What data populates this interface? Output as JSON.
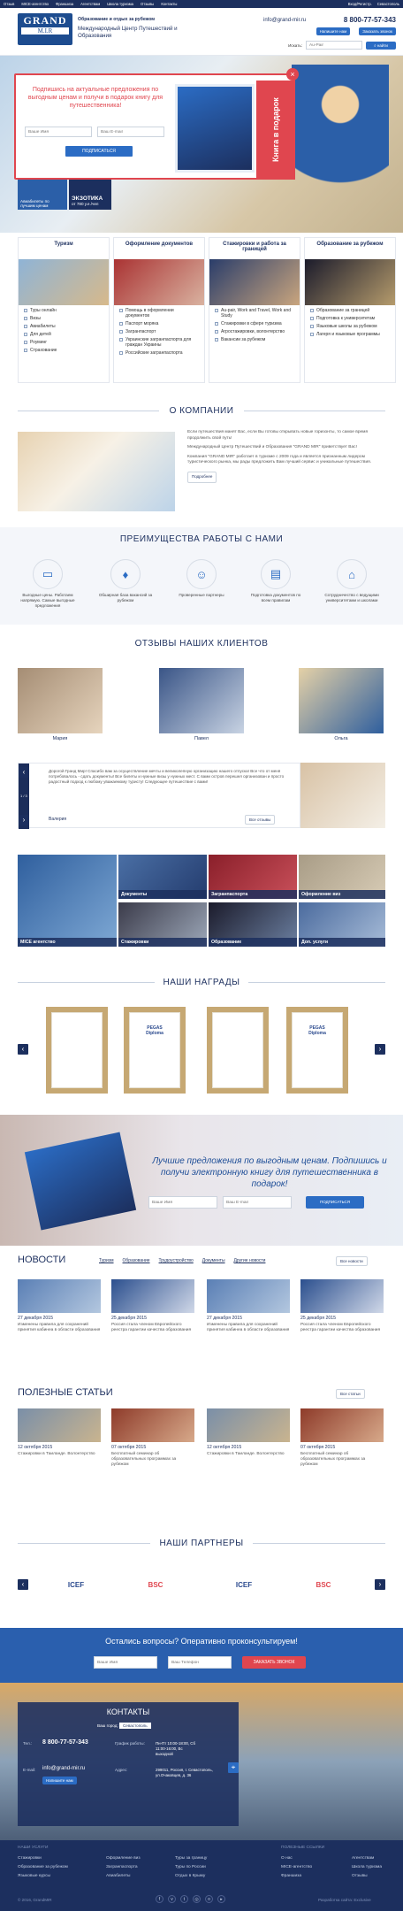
{
  "topbar": {
    "items": [
      "Отзыв",
      "MICE-агентство",
      "Франшиза",
      "Агентствам",
      "Школа туризма",
      "Отзывы",
      "Контакты"
    ],
    "login": "Вход/Регистр.",
    "city": "Севастополь"
  },
  "header": {
    "logo_main": "GRAND",
    "logo_sub": "M.I.R",
    "tagline": "Образование и отдых за рубежом",
    "org": "Международный Центр Путешествий и Образования",
    "email": "info@grand-mir.ru",
    "phone": "8 800-77-57-343",
    "callback_btn": "Напишите нам",
    "order_btn": "Заказать звонок",
    "search_label": "Искать:",
    "search_placeholder": "Au-Pair",
    "search_btn": "найти"
  },
  "popup": {
    "text": "Подпишись на актуальные предложения по выгодным ценам и получи в подарок книгу для путешественника!",
    "name_placeholder": "Ваше Имя",
    "email_placeholder": "Ваш E-mail",
    "subscribe": "ПОДПИСАТЬСЯ",
    "book_label": "Книга в подарок",
    "close": "×"
  },
  "hero": {
    "badge1": "Авиабилеты по лучшим ценам",
    "badge2_title": "ЭКЗОТИКА",
    "badge2_price": "от 780 у.е./чел"
  },
  "services": [
    {
      "title": "Туризм",
      "items": [
        "Туры онлайн",
        "Визы",
        "Авиабилеты",
        "Для детей",
        "Роуминг",
        "Страхование"
      ]
    },
    {
      "title": "Оформление документов",
      "items": [
        "Помощь в оформлении документов",
        "Паспорт моряка",
        "Загранпаспорт",
        "Украинские загранпаспорта для граждан Украины",
        "Российские загранпаспорта"
      ]
    },
    {
      "title": "Стажировки и работа за границей",
      "items": [
        "Au-pair, Work and Travel, Work and Study",
        "Стажировки в сфере туризма",
        "Агростажировки, волонтерство",
        "Вакансии за рубежом"
      ]
    },
    {
      "title": "Образование за рубежом",
      "items": [
        "Образование за границей",
        "Подготовка к университетам",
        "Языковые школы за рубежом",
        "Лагеря и языковые программы"
      ]
    }
  ],
  "about": {
    "title": "О КОМПАНИИ",
    "p1": "Если путешествия манят Вас, если Вы готовы открывать новые горизонты, то самое время продолжить свой путь!",
    "p2": "Международный Центр Путешествий и Образования \"GRAND MIR\" приветствует Вас!",
    "p3": "Компания \"GRAND MIR\" работает в туризме с 2009 года и является признанным лидером туристического рынка, мы рады предложить Вам лучший сервис и уникальные путешествия.",
    "more": "Подробнее"
  },
  "advantages": {
    "title": "ПРЕИМУЩЕСТВА РАБОТЫ С НАМИ",
    "items": [
      "Выгодные цены. Работаем напрямую. Самые выгодные предложения",
      "Обширная база вакансий за рубежом",
      "Проверенные партнеры",
      "Подготовка документов по всем правилам",
      "Сотрудничество с ведущими университетами и школами"
    ]
  },
  "reviews": {
    "title": "ОТЗЫВЫ НАШИХ КЛИЕНТОВ",
    "people": [
      "Мария",
      "Павел",
      "Ольга"
    ],
    "counter": "1 / 3",
    "text": "Дорогой Гранд Мир! Спасибо вам за осуществление мечты и великолепную организацию нашего отпуска! Все что от меня потребовалось - сдать документы! Все билеты и нужные визы у нужных мест. С вами остров перешел организован и просто радостный подход к любому уважаемому туристу! Следующее путешествие с вами!",
    "author": "Валерия",
    "all": "Все отзывы"
  },
  "tiles": [
    "MICE агентство",
    "Документы",
    "Загранпаспорта",
    "Оформление виз",
    "Стажировки",
    "Образование",
    "Доп. услуги"
  ],
  "awards": {
    "title": "НАШИ НАГРАДЫ",
    "labels": [
      "PEGAS",
      "Diploma"
    ]
  },
  "subscribe2": {
    "text": "Лучшие предложения по выгодным ценам. Подпишись и получи электронную книгу для путешественника в подарок!",
    "name_placeholder": "Ваше Имя",
    "email_placeholder": "Ваш E-mail",
    "btn": "ПОДПИСАТЬСЯ"
  },
  "news": {
    "title": "НОВОСТИ",
    "tabs": [
      "Туризм",
      "Образование",
      "Трудоустройство",
      "Документы",
      "Другие новости"
    ],
    "all": "Все новости",
    "items": [
      {
        "date": "27 декабря 2015",
        "text": "Изменены правила для сохранений принятия кабинеа в области образования"
      },
      {
        "date": "25 декабря 2015",
        "text": "Россия стала членом Европейского реестра гарантии качества образования"
      },
      {
        "date": "27 декабря 2015",
        "text": "Изменены правила для сохранений принятия кабинеа в области образования"
      },
      {
        "date": "25 декабря 2015",
        "text": "Россия стала членом Европейского реестра гарантии качества образования"
      }
    ]
  },
  "articles": {
    "title": "ПОЛЕЗНЫЕ СТАТЬИ",
    "all": "Все статьи",
    "items": [
      {
        "date": "12 октября 2015",
        "text": "Стажировки в Таиланде. Волонтерство"
      },
      {
        "date": "07 октября 2015",
        "text": "Бесплатный семинар об образовательных программах за рубежом"
      },
      {
        "date": "12 октября 2015",
        "text": "Стажировки в Таиланде. Волонтерство"
      },
      {
        "date": "07 октября 2015",
        "text": "Бесплатный семинар об образовательных программах за рубежом"
      }
    ]
  },
  "partners": {
    "title": "НАШИ ПАРТНЕРЫ",
    "logos": [
      "ICEF",
      "BSC",
      "ICEF",
      "BSC"
    ]
  },
  "cta": {
    "text": "Остались вопросы? Оперативно проконсультируем!",
    "name_placeholder": "Ваше Имя",
    "phone_placeholder": "Ваш Телефон",
    "btn": "ЗАКАЗАТЬ ЗВОНОК"
  },
  "contacts": {
    "title": "КОНТАКТЫ",
    "city_label": "Ваш город:",
    "city": "Севастополь",
    "phone_label": "Тел.:",
    "phone": "8 800-77-57-343",
    "email_label": "E-mail:",
    "email": "info@grand-mir.ru",
    "write": "Напишите нам",
    "hours_label": "График работы:",
    "hours": "Пн-Пт 10:00-18:00, Сб 11:00-16:00, Вс выходной",
    "address_label": "Адрес:",
    "address": "299011, Россия, г. Севастополь, ул.Очаковцев, д. 36"
  },
  "footer": {
    "col1_title": "НАШИ УСЛУГИ",
    "col1": [
      "Стажировки",
      "Образование за рубежом",
      "Языковые курсы"
    ],
    "col2": [
      "Оформление виз",
      "Загранпаспорта",
      "Авиабилеты"
    ],
    "col3": [
      "Туры за границу",
      "Туры по России",
      "Отдых в Крыму"
    ],
    "col4_title": "ПОЛЕЗНЫЕ ССЫЛКИ",
    "col4": [
      "О нас",
      "MICE-агентство",
      "Франшиза"
    ],
    "col5": [
      "Агентствам",
      "Школа туризма",
      "Отзывы"
    ],
    "copy": "© 2016, GrandMIR",
    "dev": "Разработка сайта: Exclusive"
  }
}
